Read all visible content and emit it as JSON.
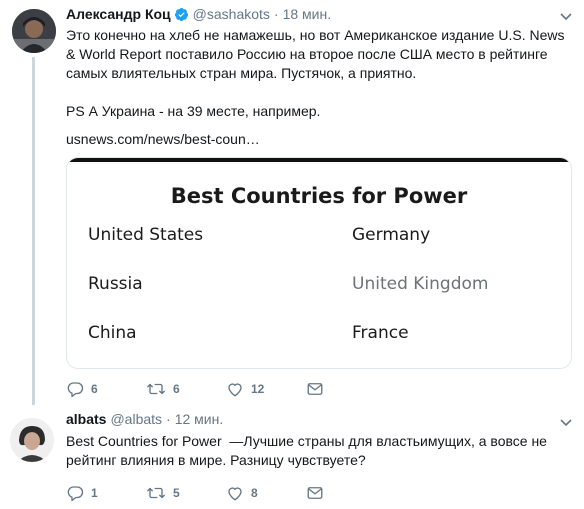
{
  "tweets": [
    {
      "author": "Александр Коц",
      "handle": "@sashakots",
      "separator": "·",
      "time": "18 мин.",
      "verified": true,
      "text": "Это конечно на хлеб не намажешь, но вот Американское издание U.S. News\n& World Report поставило Россию на второе после США место в рейтинге\nсамых влиятельных стран мира. Пустячок, а приятно.\n\nPS А Украина - на 39 месте, например.",
      "link": "usnews.com/news/best-coun…",
      "card": {
        "title": "Best Countries for Power",
        "countries": [
          "United States",
          "Germany",
          "Russia",
          "United Kingdom",
          "China",
          "France"
        ]
      },
      "actions": {
        "replies": "6",
        "retweets": "6",
        "likes": "12"
      }
    },
    {
      "author": "albats",
      "handle": "@albats",
      "separator": "·",
      "time": "12 мин.",
      "verified": false,
      "text": "Best Countries for Power  —Лучшие страны для властьимущих, а вовсе не\nрейтинг влияния в мире. Разницу чувствуете?",
      "actions": {
        "replies": "1",
        "retweets": "5",
        "likes": "8"
      }
    }
  ],
  "colors": {
    "text": "#14171a",
    "secondary": "#657786",
    "verified": "#1da1f2",
    "thread_line": "#ccd6dd",
    "card_border": "#e1e8ed"
  },
  "icons": [
    "verified-badge-icon",
    "chevron-down-icon",
    "reply-icon",
    "retweet-icon",
    "like-icon",
    "message-icon"
  ]
}
